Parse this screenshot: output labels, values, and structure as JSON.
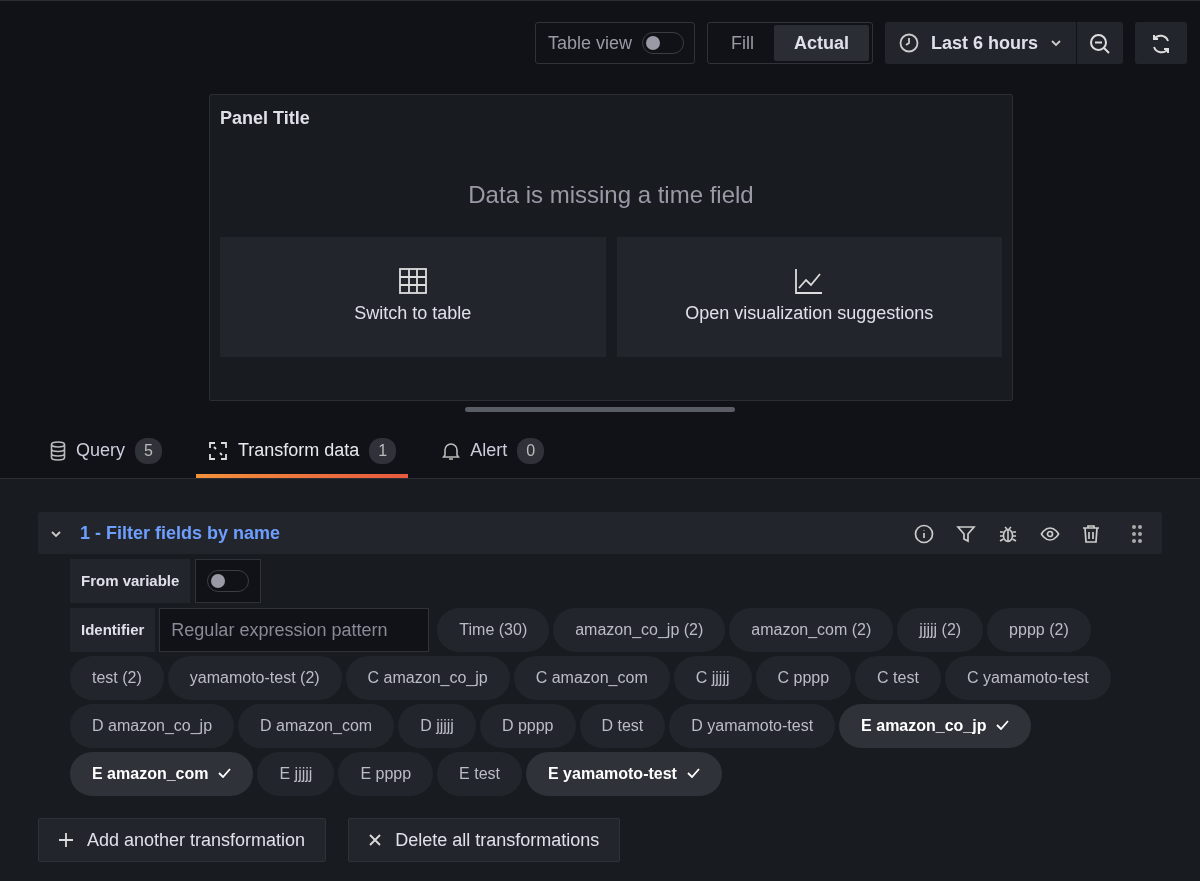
{
  "toolbar": {
    "table_view": {
      "label": "Table view",
      "on": false
    },
    "fill_modes": [
      {
        "label": "Fill",
        "selected": false
      },
      {
        "label": "Actual",
        "selected": true
      }
    ],
    "time_range": "Last 6 hours"
  },
  "panel": {
    "title": "Panel Title",
    "message": "Data is missing a time field",
    "actions": [
      {
        "kind": "table",
        "label": "Switch to table"
      },
      {
        "kind": "chart",
        "label": "Open visualization suggestions"
      }
    ]
  },
  "tabs": [
    {
      "kind": "query",
      "label": "Query",
      "count": "5",
      "selected": false
    },
    {
      "kind": "transform",
      "label": "Transform data",
      "count": "1",
      "selected": true
    },
    {
      "kind": "alert",
      "label": "Alert",
      "count": "0",
      "selected": false
    }
  ],
  "transformation": {
    "title": "1 - Filter fields by name",
    "expanded": true,
    "from_variable": {
      "label": "From variable",
      "on": false
    },
    "identifier": {
      "label": "Identifier",
      "placeholder": "Regular expression pattern"
    },
    "fields": [
      {
        "label": "Time (30)",
        "selected": false
      },
      {
        "label": "amazon_co_jp (2)",
        "selected": false
      },
      {
        "label": "amazon_com (2)",
        "selected": false
      },
      {
        "label": "jjjjj (2)",
        "selected": false
      },
      {
        "label": "pppp (2)",
        "selected": false
      },
      {
        "label": "test (2)",
        "selected": false
      },
      {
        "label": "yamamoto-test (2)",
        "selected": false
      },
      {
        "label": "C amazon_co_jp",
        "selected": false
      },
      {
        "label": "C amazon_com",
        "selected": false
      },
      {
        "label": "C jjjjj",
        "selected": false
      },
      {
        "label": "C pppp",
        "selected": false
      },
      {
        "label": "C test",
        "selected": false
      },
      {
        "label": "C yamamoto-test",
        "selected": false
      },
      {
        "label": "D amazon_co_jp",
        "selected": false
      },
      {
        "label": "D amazon_com",
        "selected": false
      },
      {
        "label": "D jjjjj",
        "selected": false
      },
      {
        "label": "D pppp",
        "selected": false
      },
      {
        "label": "D test",
        "selected": false
      },
      {
        "label": "D yamamoto-test",
        "selected": false
      },
      {
        "label": "E amazon_co_jp",
        "selected": true
      },
      {
        "label": "E amazon_com",
        "selected": true
      },
      {
        "label": "E jjjjj",
        "selected": false
      },
      {
        "label": "E pppp",
        "selected": false
      },
      {
        "label": "E test",
        "selected": false
      },
      {
        "label": "E yamamoto-test",
        "selected": true
      }
    ]
  },
  "buttons": [
    {
      "kind": "add",
      "label": "Add another transformation"
    },
    {
      "kind": "delete",
      "label": "Delete all transformations"
    }
  ]
}
